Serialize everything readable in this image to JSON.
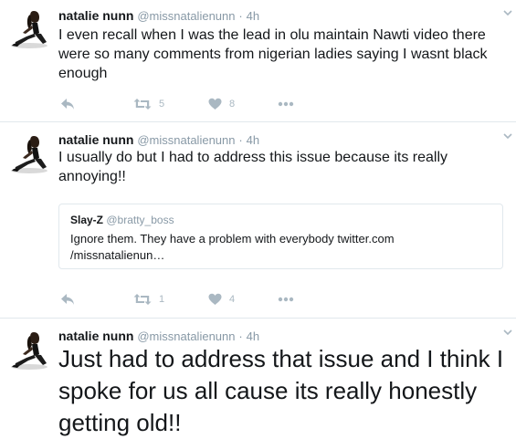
{
  "tweets": [
    {
      "name": "natalie nunn",
      "handle": "@missnatalienunn",
      "separator": "·",
      "time": "4h",
      "text": "I even recall when I was the lead in olu maintain Nawti video there were so many comments from nigerian ladies saying I wasnt black enough",
      "retweets": "5",
      "likes": "8"
    },
    {
      "name": "natalie nunn",
      "handle": "@missnatalienunn",
      "separator": "·",
      "time": "4h",
      "text": "I usually do but I had to address this issue because its really annoying!!",
      "quote": {
        "name": "Slay-Z",
        "handle": "@bratty_boss",
        "text": "Ignore them. They have a problem with everybody  twitter.com /missnatalienun…"
      },
      "retweets": "1",
      "likes": "4"
    },
    {
      "name": "natalie nunn",
      "handle": "@missnatalienunn",
      "separator": "·",
      "time": "4h",
      "text": "Just had to address that issue and I think I spoke for us all cause its really honestly getting old!!"
    }
  ],
  "icons": {
    "reply": "reply-icon",
    "retweet": "retweet-icon",
    "like": "heart-icon",
    "more": "more-dots-icon",
    "caret": "chevron-down-icon"
  },
  "colors": {
    "icon_gray": "#aab8c2",
    "meta_gray": "#8899a6",
    "text": "#14171a",
    "divider": "#e1e8ed"
  }
}
